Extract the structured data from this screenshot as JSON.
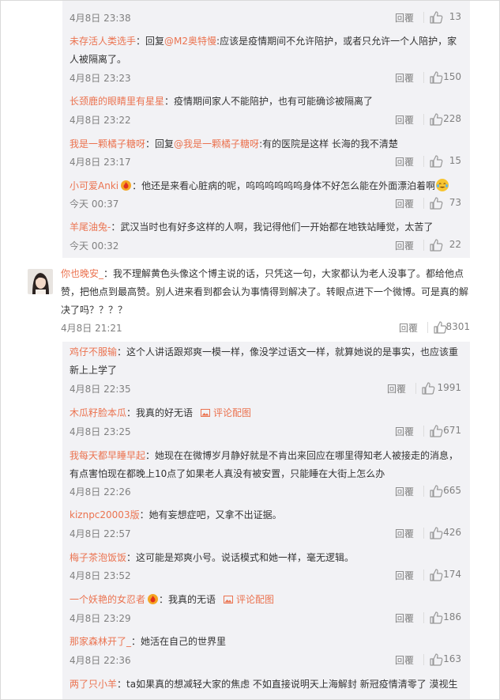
{
  "reply_label": "回覆",
  "top_comment": {
    "time": "4月8日 23:38",
    "likes": "13"
  },
  "replies_a": [
    {
      "user": "未存活人类选手",
      "colon": "：",
      "prefix": "回复",
      "at": "@M2奥特慢",
      "text": ":应该是疫情期间不允许陪护，或者只允许一个人陪护，家人被隔离了。",
      "time": "4月8日 23:23",
      "likes": "150"
    },
    {
      "user": "长颈鹿的眼睛里有星星",
      "colon": "：",
      "text": "疫情期间家人不能陪护，也有可能确诊被隔离了",
      "time": "4月8日 23:22",
      "likes": "228"
    },
    {
      "user": "我是一颗橘子糖呀",
      "colon": "：",
      "prefix": "回复",
      "at": "@我是一颗橘子糖呀",
      "text": ":有的医院是这样 长海的我不清楚",
      "time": "4月8日 23:17",
      "likes": "15"
    },
    {
      "user": "小可爱Anki",
      "colon": "：",
      "text": "他还是来看心脏病的呢，呜呜呜呜呜呜身体不好怎么能在外面漂泊着啊",
      "time": "今天 00:37",
      "likes": "73"
    },
    {
      "user": "羊尾油兔-",
      "colon": "：",
      "text": "武汉当时也有好多这样的人啊，我记得他们一开始都在地铁站睡觉，太苦了",
      "time": "今天 00:32",
      "likes": "22"
    }
  ],
  "main_comment": {
    "user": "你也晚安_",
    "colon": "：",
    "text": "我不理解黄色头像这个博主说的话，只凭这一句，大家都认为老人没事了。都给他点赞，把他点到最高赞。别人进来看到都会认为事情得到解决了。转眼点进下一个微博。可是真的解决了吗？？？？",
    "time": "4月8日 21:21",
    "likes": "8301"
  },
  "replies_b": [
    {
      "user": "鸡仔不服输",
      "colon": "：",
      "text": "这个人讲话跟郑爽一模一样，像没学过语文一样，就算她说的是事实，也应该重新上上学了",
      "time": "4月8日 22:35",
      "likes": "1991"
    },
    {
      "user": "木瓜籽脸本瓜",
      "colon": "：",
      "text": "我真的好无语",
      "pic": "评论配图",
      "time": "4月8日 23:25",
      "likes": "671"
    },
    {
      "user": "我每天都早睡早起",
      "colon": "：",
      "text": "她现在在微博岁月静好就是不肯出来回应在哪里得知老人被接走的消息，有点害怕现在都晚上10点了如果老人真没有被安置，只能睡在大街上怎么办",
      "time": "4月8日 22:26",
      "likes": "665"
    },
    {
      "user": "kiznpc20003版",
      "colon": "：",
      "text": "她有妄想症吧，又拿不出证据。",
      "time": "4月8日 22:57",
      "likes": "426"
    },
    {
      "user": "梅子茶泡饭饭",
      "colon": "：",
      "text": "这可能是郑爽小号。说话模式和她一样，毫无逻辑。",
      "time": "4月8日 23:52",
      "likes": "174"
    },
    {
      "user": "一个妖艳的女忍者",
      "colon": "：",
      "text": "我真的无语",
      "pic": "评论配图",
      "time": "4月8日 23:29",
      "likes": "186"
    },
    {
      "user": "那家森林开了_",
      "colon": "：",
      "text": "她活在自己的世界里",
      "time": "4月8日 22:36",
      "likes": "163"
    },
    {
      "user": "两了只小羊",
      "colon": "：",
      "text": "ta如果真的想减轻大家的焦虑 不如直接说明天上海解封 新冠疫情清零了 漠视生"
    }
  ],
  "colors": {
    "username": "#eb7350",
    "panel": "#f2f2f5",
    "meta": "#808080"
  },
  "icons": {
    "like": "thumbs-up-icon",
    "badge": "fire-badge-icon",
    "picture": "image-icon",
    "emoji": "crying-laughing-emoji-icon"
  }
}
